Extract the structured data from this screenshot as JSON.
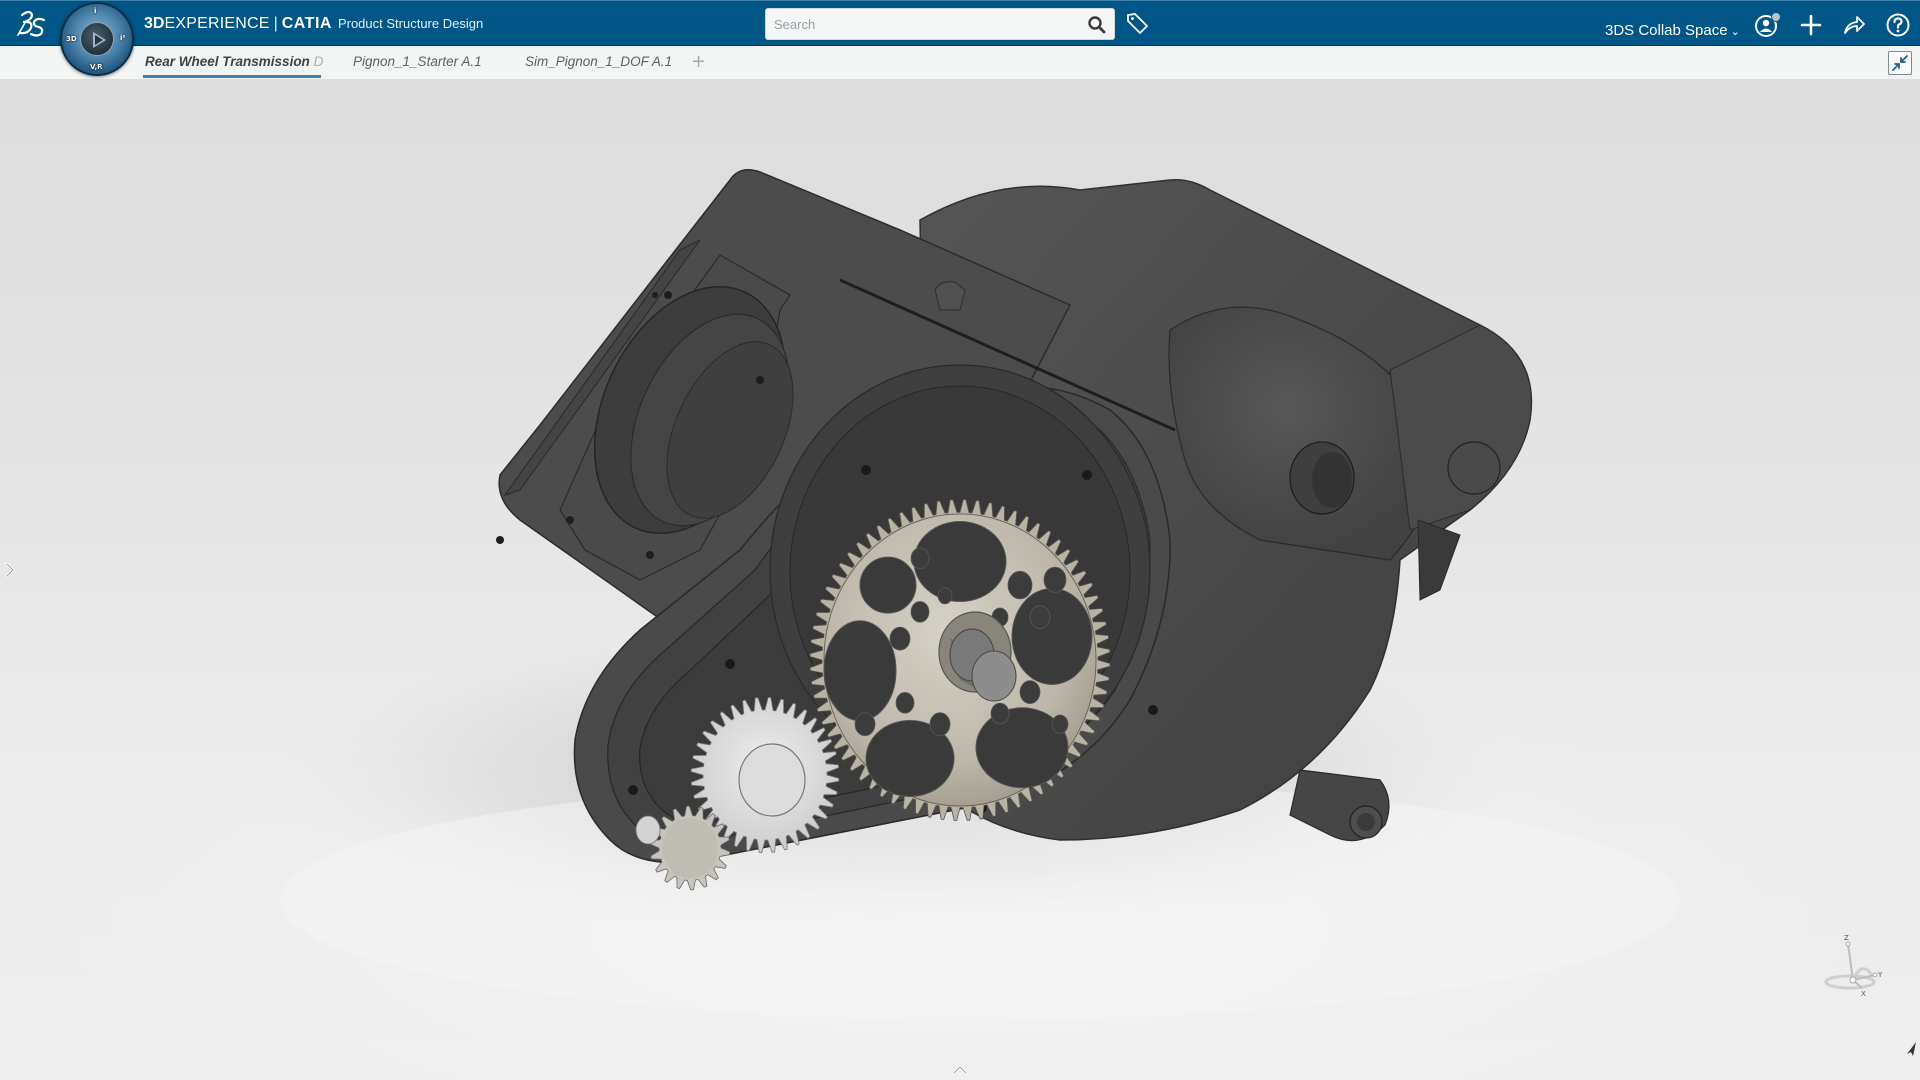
{
  "header": {
    "brand_prefix": "3D",
    "brand_experience": "EXPERIENCE",
    "brand_separator": "|",
    "brand_product": "CATIA",
    "app_name": "Product Structure Design",
    "logo_text": "3DS",
    "search": {
      "value": "",
      "placeholder": "Search"
    },
    "collab_space": "3DS Collab Space",
    "icons": {
      "logo": "dassault-systemes-logo",
      "search": "search-icon",
      "tag": "tag-icon",
      "profile": "user-profile-icon",
      "add": "plus-icon",
      "share": "share-icon",
      "help": "help-icon"
    }
  },
  "compass": {
    "labels": {
      "top": "i",
      "left": "3D",
      "right": "i²",
      "bottom": "V,R"
    },
    "icon": "play-icon"
  },
  "tabs": [
    {
      "label": "Rear Wheel Transmission",
      "suffix": "D",
      "active": true
    },
    {
      "label": "Pignon_1_Starter A.1",
      "active": false
    },
    {
      "label": "Sim_Pignon_1_DOF A.1",
      "active": false
    }
  ],
  "tab_add_label": "+",
  "viewport": {
    "model": "Rear Wheel Transmission gearbox assembly",
    "axis_labels": {
      "x": "X",
      "y": "Y",
      "z": "Z"
    }
  },
  "colors": {
    "header_bg": "#005686",
    "tab_bar_bg": "#f3f4f4",
    "active_tab_underline": "#3f7fb1",
    "housing": "#4a4a4a",
    "gear_metal": "#c9c4b8"
  }
}
